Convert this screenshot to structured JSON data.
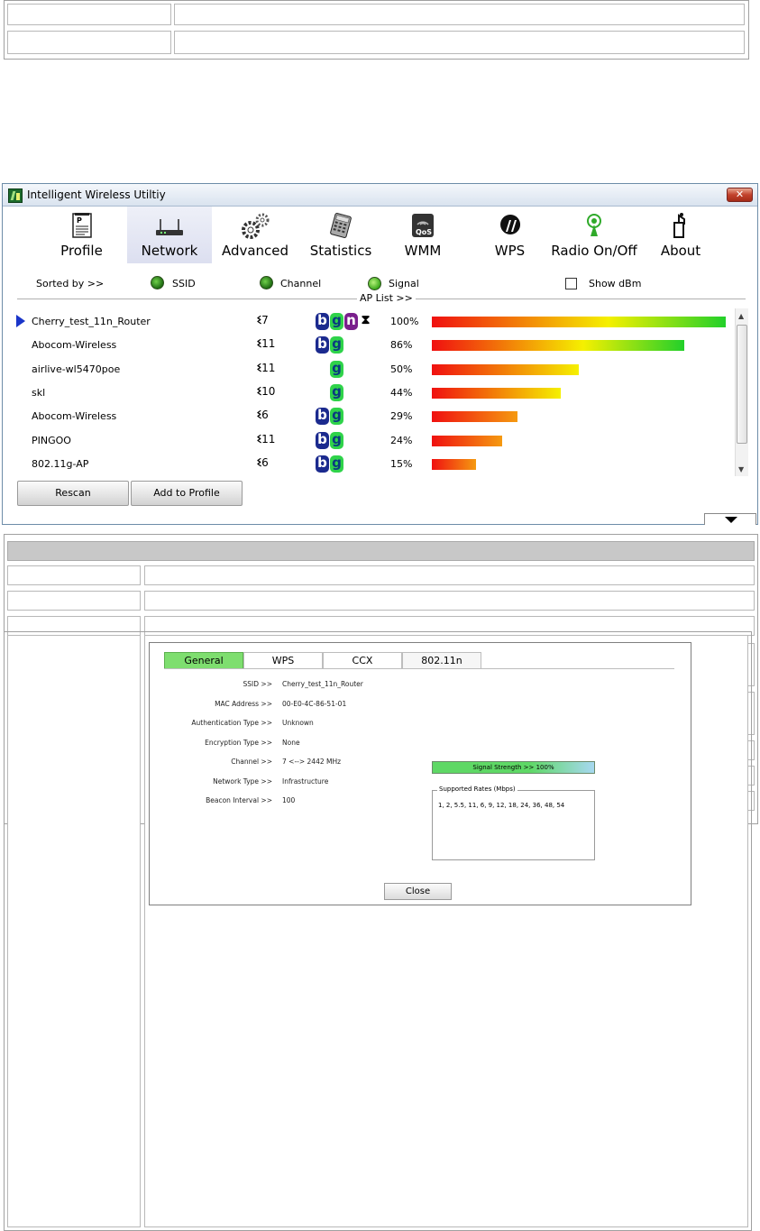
{
  "window": {
    "title": "Intelligent Wireless Utiltiy",
    "close_label": "✕"
  },
  "toolbar": {
    "items": [
      {
        "label": "Profile",
        "icon": "profile-icon"
      },
      {
        "label": "Network",
        "icon": "network-icon",
        "active": true
      },
      {
        "label": "Advanced",
        "icon": "advanced-gears-icon"
      },
      {
        "label": "Statistics",
        "icon": "statistics-icon"
      },
      {
        "label": "WMM",
        "icon": "wmm-qos-icon"
      },
      {
        "label": "WPS",
        "icon": "wps-icon"
      },
      {
        "label": "Radio On/Off",
        "icon": "radio-icon"
      },
      {
        "label": "About",
        "icon": "about-icon"
      }
    ]
  },
  "sort": {
    "label": "Sorted by >>",
    "options": [
      "SSID",
      "Channel",
      "Signal"
    ],
    "show_dbm": "Show dBm",
    "ap_list": "AP List >>"
  },
  "ap_list": [
    {
      "ssid": "Cherry_test_11n_Router",
      "channel": "7",
      "modes": [
        "b",
        "g",
        "n",
        "wps"
      ],
      "signal": 100,
      "signal_text": "100%",
      "selected": true
    },
    {
      "ssid": "Abocom-Wireless",
      "channel": "11",
      "modes": [
        "b",
        "g"
      ],
      "signal": 86,
      "signal_text": "86%"
    },
    {
      "ssid": "airlive-wl5470poe",
      "channel": "11",
      "modes": [
        "g"
      ],
      "signal": 50,
      "signal_text": "50%"
    },
    {
      "ssid": "skl",
      "channel": "10",
      "modes": [
        "g"
      ],
      "signal": 44,
      "signal_text": "44%"
    },
    {
      "ssid": "Abocom-Wireless",
      "channel": "6",
      "modes": [
        "b",
        "g"
      ],
      "signal": 29,
      "signal_text": "29%"
    },
    {
      "ssid": "PINGOO",
      "channel": "11",
      "modes": [
        "b",
        "g"
      ],
      "signal": 24,
      "signal_text": "24%"
    },
    {
      "ssid": "802.11g-AP",
      "channel": "6",
      "modes": [
        "b",
        "g"
      ],
      "signal": 15,
      "signal_text": "15%"
    }
  ],
  "buttons": {
    "rescan": "Rescan",
    "add_profile": "Add to Profile"
  },
  "dialog": {
    "tabs": [
      "General",
      "WPS",
      "CCX",
      "802.11n"
    ],
    "fields": [
      {
        "key": "SSID >>",
        "value": "Cherry_test_11n_Router"
      },
      {
        "key": "MAC Address >>",
        "value": "00-E0-4C-86-51-01"
      },
      {
        "key": "Authentication Type >>",
        "value": "Unknown"
      },
      {
        "key": "Encryption Type >>",
        "value": "None"
      },
      {
        "key": "Channel >>",
        "value": "7 <--> 2442 MHz"
      },
      {
        "key": "Network Type >>",
        "value": "Infrastructure"
      },
      {
        "key": "Beacon Interval >>",
        "value": "100"
      }
    ],
    "signal_strength": "Signal Strength >> 100%",
    "signal_value": 100,
    "rates_label": "Supported Rates (Mbps)",
    "rates_value": "1, 2, 5.5, 11, 6, 9, 12, 18, 24, 36, 48, 54",
    "close": "Close"
  },
  "colors": {
    "accent_selected": "#1a35c9",
    "signal_gradient": [
      "#f01010",
      "#f5f000",
      "#22d02a"
    ]
  }
}
